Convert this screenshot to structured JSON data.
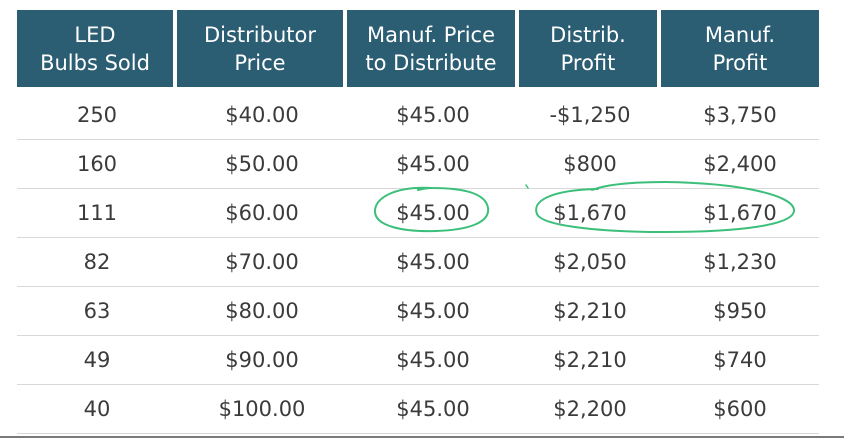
{
  "table": {
    "headers": [
      [
        "LED",
        "Bulbs Sold"
      ],
      [
        "Distributor",
        "Price"
      ],
      [
        "Manuf. Price",
        "to Distribute"
      ],
      [
        "Distrib.",
        "Profit"
      ],
      [
        "Manuf.",
        "Profit"
      ]
    ],
    "rows": [
      [
        "250",
        "$40.00",
        "$45.00",
        "-$1,250",
        "$3,750"
      ],
      [
        "160",
        "$50.00",
        "$45.00",
        "$800",
        "$2,400"
      ],
      [
        "111",
        "$60.00",
        "$45.00",
        "$1,670",
        "$1,670"
      ],
      [
        "82",
        "$70.00",
        "$45.00",
        "$2,050",
        "$1,230"
      ],
      [
        "63",
        "$80.00",
        "$45.00",
        "$2,210",
        "$950"
      ],
      [
        "49",
        "$90.00",
        "$45.00",
        "$2,210",
        "$740"
      ],
      [
        "40",
        "$100.00",
        "$45.00",
        "$2,200",
        "$600"
      ]
    ]
  },
  "colors": {
    "header_bg": "#2b5d73",
    "header_text": "#ffffff",
    "cell_text": "#3b3b3b",
    "annotation_ink": "#3cbf7a"
  }
}
